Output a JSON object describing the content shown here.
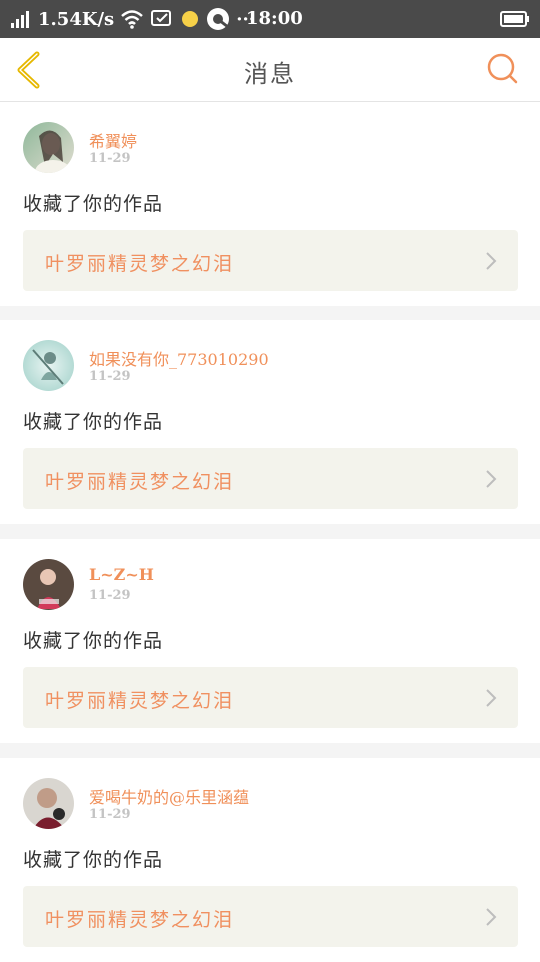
{
  "status_bar": {
    "speed": "1.54K/s",
    "time": "18:00",
    "more": "···"
  },
  "header": {
    "title": "消息"
  },
  "colors": {
    "accent": "#f0905a",
    "back_icon": "#e6b800",
    "card_link_bg": "#f3f3ec",
    "status_bar": "#4a4a4a"
  },
  "notifications": [
    {
      "username": "希翼婷",
      "date": "11-29",
      "action": "收藏了你的作品",
      "work_title": "叶罗丽精灵梦之幻泪"
    },
    {
      "username": "如果没有你_773010290",
      "date": "11-29",
      "action": "收藏了你的作品",
      "work_title": "叶罗丽精灵梦之幻泪"
    },
    {
      "username": "L~Z~H",
      "date": "11-29",
      "action": "收藏了你的作品",
      "work_title": "叶罗丽精灵梦之幻泪"
    },
    {
      "username": "爱喝牛奶的@乐里涵蕴",
      "date": "11-29",
      "action": "收藏了你的作品",
      "work_title": "叶罗丽精灵梦之幻泪"
    }
  ]
}
